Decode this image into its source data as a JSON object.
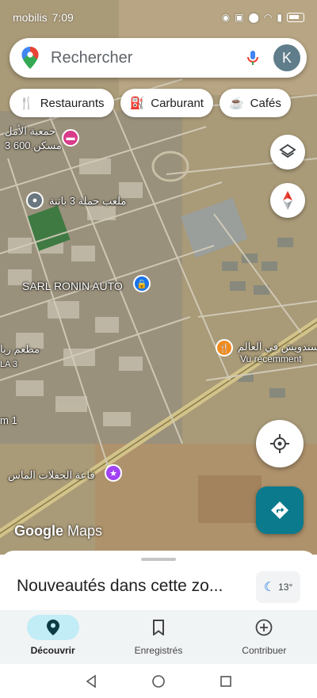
{
  "status_bar": {
    "carrier": "mobilis",
    "time": "7:09"
  },
  "search": {
    "placeholder": "Rechercher",
    "avatar_letter": "K"
  },
  "chips": [
    {
      "label": "Restaurants",
      "icon": "fork-knife-icon"
    },
    {
      "label": "Carburant",
      "icon": "fuel-icon"
    },
    {
      "label": "Cafés",
      "icon": "coffee-icon"
    }
  ],
  "map": {
    "labels": {
      "poi_association": "جمعية الأمل",
      "poi_association_sub": "3 600 مسكن",
      "poi_stadium": "ملعب حملة 3 باتنة",
      "poi_sarl": "SARL RONIN AUTO",
      "poi_restaurant": "مطعم ربا",
      "poi_restaurant_sub": "LA 3",
      "poi_sandwich": "سندويش في العالم",
      "poi_sandwich_sub": "Vu récemment",
      "poi_hall": "قاعة الحفلات الماس",
      "edge_label": "m 1"
    },
    "attribution": {
      "google": "Google",
      "maps": "Maps"
    }
  },
  "sheet": {
    "title": "Nouveautés dans cette zo...",
    "weather_temp": "13°"
  },
  "nav": [
    {
      "label": "Découvrir",
      "active": true
    },
    {
      "label": "Enregistrés",
      "active": false
    },
    {
      "label": "Contribuer",
      "active": false
    }
  ],
  "colors": {
    "accent": "#0b7a8c",
    "active_nav": "#c2ecf6",
    "compass_red": "#d93025"
  }
}
